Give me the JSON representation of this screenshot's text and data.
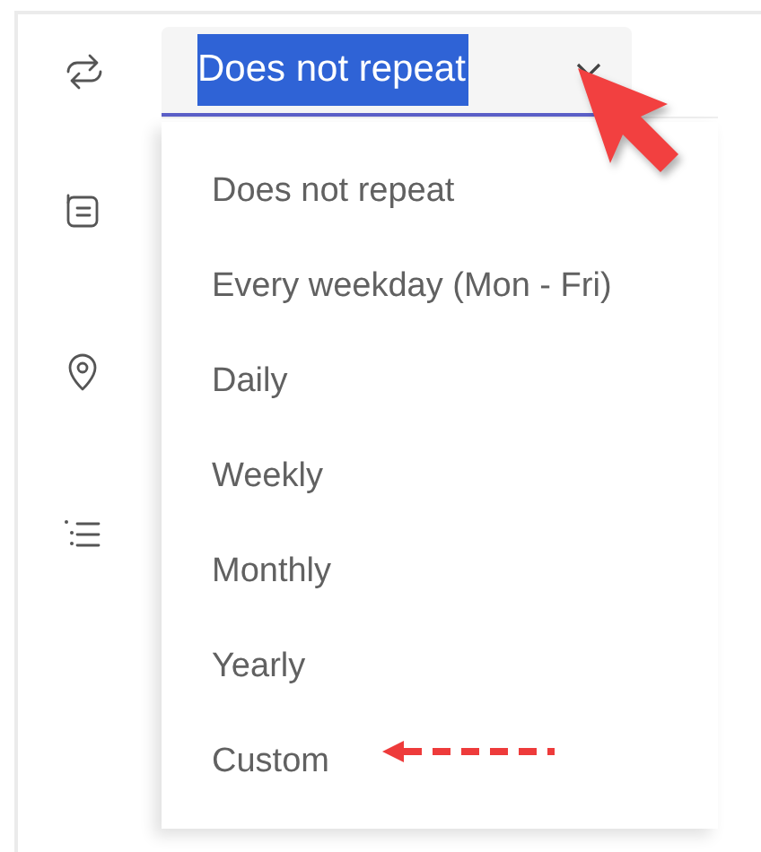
{
  "side_icons": [
    {
      "kind": "repeat"
    },
    {
      "kind": "note"
    },
    {
      "kind": "location"
    },
    {
      "kind": "list"
    }
  ],
  "repeat_field": {
    "value": "Does not repeat",
    "text_selected": true,
    "expanded": true
  },
  "options": [
    {
      "label": "Does not repeat"
    },
    {
      "label": "Every weekday (Mon - Fri)"
    },
    {
      "label": "Daily"
    },
    {
      "label": "Weekly"
    },
    {
      "label": "Monthly"
    },
    {
      "label": "Yearly"
    },
    {
      "label": "Custom"
    }
  ],
  "annotations": [
    {
      "kind": "cursor"
    },
    {
      "kind": "dashed_arrow"
    }
  ]
}
